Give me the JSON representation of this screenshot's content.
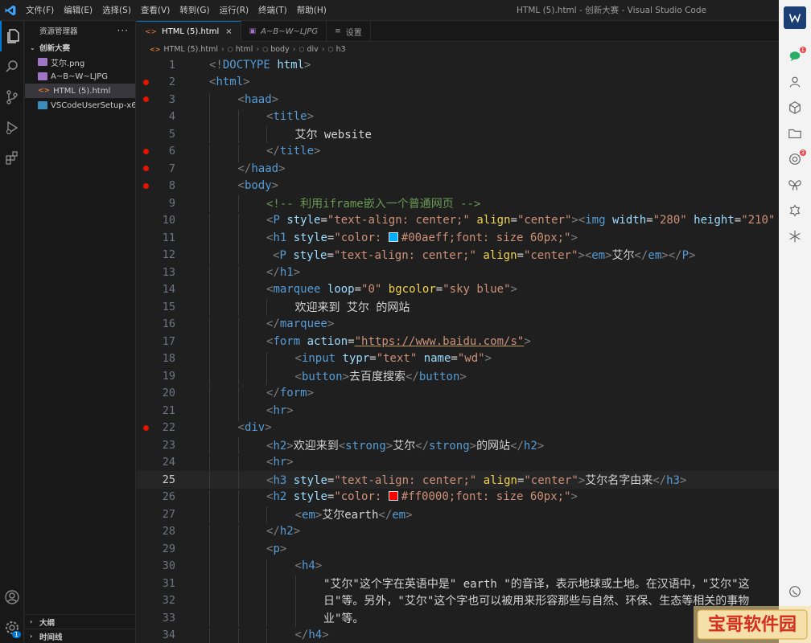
{
  "window": {
    "title": "HTML (5).html - 创新大赛 - Visual Studio Code",
    "menus": [
      "文件(F)",
      "编辑(E)",
      "选择(S)",
      "查看(V)",
      "转到(G)",
      "运行(R)",
      "终端(T)",
      "帮助(H)"
    ]
  },
  "sidebar": {
    "title": "资源管理器",
    "more": "···",
    "folder": "创新大赛",
    "files": [
      {
        "name": "艾尔.png",
        "kind": "image-file-icon"
      },
      {
        "name": "A~B~W~LJPG",
        "kind": "image-file-icon"
      },
      {
        "name": "HTML (5).html",
        "kind": "html-file-icon",
        "selected": true
      },
      {
        "name": "VSCodeUserSetup-x6...",
        "kind": "exe-file-icon"
      }
    ],
    "outline": "大纲",
    "timeline": "时间线"
  },
  "tabs": [
    {
      "label": "HTML (5).html",
      "icon": "<>",
      "active": true,
      "close": "×"
    },
    {
      "label": "A~B~W~LJPG",
      "icon": "▣",
      "italic": true
    },
    {
      "label": "设置",
      "icon": "≡"
    }
  ],
  "breadcrumb": [
    "HTML (5).html",
    "html",
    "body",
    "div",
    "h3"
  ],
  "editor": {
    "current_line": 25,
    "lines": [
      {
        "n": "1",
        "bp": false,
        "indent": 0,
        "toks": [
          [
            "p",
            "<!"
          ],
          [
            "t",
            "DOCTYPE"
          ],
          [
            "x",
            " "
          ],
          [
            "a",
            "html"
          ],
          [
            "p",
            ">"
          ]
        ]
      },
      {
        "n": "2",
        "bp": true,
        "indent": 0,
        "toks": [
          [
            "p",
            "<"
          ],
          [
            "t",
            "html"
          ],
          [
            "p",
            ">"
          ]
        ]
      },
      {
        "n": "3",
        "bp": true,
        "indent": 1,
        "toks": [
          [
            "p",
            "<"
          ],
          [
            "t",
            "haad"
          ],
          [
            "p",
            ">"
          ]
        ]
      },
      {
        "n": "4",
        "bp": false,
        "indent": 2,
        "toks": [
          [
            "p",
            "<"
          ],
          [
            "t",
            "title"
          ],
          [
            "p",
            ">"
          ]
        ]
      },
      {
        "n": "5",
        "bp": false,
        "indent": 3,
        "toks": [
          [
            "w",
            "艾尔 website"
          ]
        ]
      },
      {
        "n": "6",
        "bp": true,
        "indent": 2,
        "toks": [
          [
            "p",
            "</"
          ],
          [
            "t",
            "title"
          ],
          [
            "p",
            ">"
          ]
        ]
      },
      {
        "n": "7",
        "bp": true,
        "indent": 1,
        "toks": [
          [
            "p",
            "</"
          ],
          [
            "t",
            "haad"
          ],
          [
            "p",
            ">"
          ]
        ]
      },
      {
        "n": "8",
        "bp": true,
        "indent": 1,
        "toks": [
          [
            "p",
            "<"
          ],
          [
            "t",
            "body"
          ],
          [
            "p",
            ">"
          ]
        ]
      },
      {
        "n": "9",
        "bp": false,
        "indent": 2,
        "toks": [
          [
            "c",
            "<!-- 利用iframe嵌入一个普通网页 -->"
          ]
        ]
      },
      {
        "n": "10",
        "bp": false,
        "indent": 2,
        "toks": [
          [
            "p",
            "<"
          ],
          [
            "t",
            "P"
          ],
          [
            "x",
            " "
          ],
          [
            "a",
            "style"
          ],
          [
            "x",
            "="
          ],
          [
            "s",
            "\"text-align: center;\""
          ],
          [
            "x",
            " "
          ],
          [
            "e",
            "align"
          ],
          [
            "x",
            "="
          ],
          [
            "s",
            "\"center\""
          ],
          [
            "p",
            "><"
          ],
          [
            "t",
            "img"
          ],
          [
            "x",
            " "
          ],
          [
            "a",
            "width"
          ],
          [
            "x",
            "="
          ],
          [
            "s",
            "\"280\""
          ],
          [
            "x",
            " "
          ],
          [
            "a",
            "height"
          ],
          [
            "x",
            "="
          ],
          [
            "s",
            "\"210\""
          ]
        ]
      },
      {
        "n": "11",
        "bp": false,
        "indent": 2,
        "toks": [
          [
            "p",
            "<"
          ],
          [
            "t",
            "h1"
          ],
          [
            "x",
            " "
          ],
          [
            "a",
            "style"
          ],
          [
            "x",
            "="
          ],
          [
            "s",
            "\"color: "
          ],
          [
            "sw",
            "#00aeff"
          ],
          [
            "s",
            "#00aeff;font: size 60px;\""
          ],
          [
            "p",
            ">"
          ]
        ]
      },
      {
        "n": "12",
        "bp": false,
        "indent": 2,
        "pad": 1,
        "toks": [
          [
            "p",
            "<"
          ],
          [
            "t",
            "P"
          ],
          [
            "x",
            " "
          ],
          [
            "a",
            "style"
          ],
          [
            "x",
            "="
          ],
          [
            "s",
            "\"text-align: center;\""
          ],
          [
            "x",
            " "
          ],
          [
            "e",
            "align"
          ],
          [
            "x",
            "="
          ],
          [
            "s",
            "\"center\""
          ],
          [
            "p",
            "><"
          ],
          [
            "t",
            "em"
          ],
          [
            "p",
            ">"
          ],
          [
            "w",
            "艾尔"
          ],
          [
            "p",
            "</"
          ],
          [
            "t",
            "em"
          ],
          [
            "p",
            "></"
          ],
          [
            "t",
            "P"
          ],
          [
            "p",
            ">"
          ]
        ]
      },
      {
        "n": "13",
        "bp": false,
        "indent": 2,
        "toks": [
          [
            "p",
            "</"
          ],
          [
            "t",
            "h1"
          ],
          [
            "p",
            ">"
          ]
        ]
      },
      {
        "n": "14",
        "bp": false,
        "indent": 2,
        "toks": [
          [
            "p",
            "<"
          ],
          [
            "t",
            "marquee"
          ],
          [
            "x",
            " "
          ],
          [
            "a",
            "loop"
          ],
          [
            "x",
            "="
          ],
          [
            "s",
            "\"0\""
          ],
          [
            "x",
            " "
          ],
          [
            "e",
            "bgcolor"
          ],
          [
            "x",
            "="
          ],
          [
            "s",
            "\"sky blue\""
          ],
          [
            "p",
            ">"
          ]
        ]
      },
      {
        "n": "15",
        "bp": false,
        "indent": 3,
        "toks": [
          [
            "w",
            "欢迎来到 艾尔 的网站"
          ]
        ]
      },
      {
        "n": "16",
        "bp": false,
        "indent": 2,
        "toks": [
          [
            "p",
            "</"
          ],
          [
            "t",
            "marquee"
          ],
          [
            "p",
            ">"
          ]
        ]
      },
      {
        "n": "17",
        "bp": false,
        "indent": 2,
        "toks": [
          [
            "p",
            "<"
          ],
          [
            "t",
            "form"
          ],
          [
            "x",
            " "
          ],
          [
            "a",
            "action"
          ],
          [
            "x",
            "="
          ],
          [
            "su",
            "\"https://www.baidu.com/s\""
          ],
          [
            "p",
            ">"
          ]
        ]
      },
      {
        "n": "18",
        "bp": false,
        "indent": 3,
        "toks": [
          [
            "p",
            "<"
          ],
          [
            "t",
            "input"
          ],
          [
            "x",
            " "
          ],
          [
            "a",
            "typr"
          ],
          [
            "x",
            "="
          ],
          [
            "s",
            "\"text\""
          ],
          [
            "x",
            " "
          ],
          [
            "a",
            "name"
          ],
          [
            "x",
            "="
          ],
          [
            "s",
            "\"wd\""
          ],
          [
            "p",
            ">"
          ]
        ]
      },
      {
        "n": "19",
        "bp": false,
        "indent": 3,
        "toks": [
          [
            "p",
            "<"
          ],
          [
            "t",
            "button"
          ],
          [
            "p",
            ">"
          ],
          [
            "w",
            "去百度搜索"
          ],
          [
            "p",
            "</"
          ],
          [
            "t",
            "button"
          ],
          [
            "p",
            ">"
          ]
        ]
      },
      {
        "n": "20",
        "bp": false,
        "indent": 2,
        "toks": [
          [
            "p",
            "</"
          ],
          [
            "t",
            "form"
          ],
          [
            "p",
            ">"
          ]
        ]
      },
      {
        "n": "21",
        "bp": false,
        "indent": 2,
        "toks": [
          [
            "p",
            "<"
          ],
          [
            "t",
            "hr"
          ],
          [
            "p",
            ">"
          ]
        ]
      },
      {
        "n": "22",
        "bp": true,
        "indent": 1,
        "toks": [
          [
            "p",
            "<"
          ],
          [
            "t",
            "div"
          ],
          [
            "p",
            ">"
          ]
        ]
      },
      {
        "n": "23",
        "bp": false,
        "indent": 2,
        "toks": [
          [
            "p",
            "<"
          ],
          [
            "t",
            "h2"
          ],
          [
            "p",
            ">"
          ],
          [
            "w",
            "欢迎来到"
          ],
          [
            "p",
            "<"
          ],
          [
            "t",
            "strong"
          ],
          [
            "p",
            ">"
          ],
          [
            "w",
            "艾尔"
          ],
          [
            "p",
            "</"
          ],
          [
            "t",
            "strong"
          ],
          [
            "p",
            ">"
          ],
          [
            "w",
            "的网站"
          ],
          [
            "p",
            "</"
          ],
          [
            "t",
            "h2"
          ],
          [
            "p",
            ">"
          ]
        ]
      },
      {
        "n": "24",
        "bp": false,
        "indent": 2,
        "toks": [
          [
            "p",
            "<"
          ],
          [
            "t",
            "hr"
          ],
          [
            "p",
            ">"
          ]
        ]
      },
      {
        "n": "25",
        "bp": false,
        "indent": 2,
        "toks": [
          [
            "p",
            "<"
          ],
          [
            "t",
            "h3"
          ],
          [
            "x",
            " "
          ],
          [
            "a",
            "style"
          ],
          [
            "x",
            "="
          ],
          [
            "s",
            "\"text-align: center;\""
          ],
          [
            "x",
            " "
          ],
          [
            "e",
            "align"
          ],
          [
            "x",
            "="
          ],
          [
            "s",
            "\"center\""
          ],
          [
            "p",
            ">"
          ],
          [
            "w",
            "艾尔名字由来"
          ],
          [
            "p",
            "</"
          ],
          [
            "t",
            "h3"
          ],
          [
            "p",
            ">"
          ]
        ]
      },
      {
        "n": "26",
        "bp": false,
        "indent": 2,
        "toks": [
          [
            "p",
            "<"
          ],
          [
            "t",
            "h2"
          ],
          [
            "x",
            " "
          ],
          [
            "a",
            "style"
          ],
          [
            "x",
            "="
          ],
          [
            "s",
            "\"color: "
          ],
          [
            "sw",
            "#ff0000"
          ],
          [
            "s",
            "#ff0000;font: size 60px;\""
          ],
          [
            "p",
            ">"
          ]
        ]
      },
      {
        "n": "27",
        "bp": false,
        "indent": 3,
        "toks": [
          [
            "p",
            "<"
          ],
          [
            "t",
            "em"
          ],
          [
            "p",
            ">"
          ],
          [
            "w",
            "艾尔earth"
          ],
          [
            "p",
            "</"
          ],
          [
            "t",
            "em"
          ],
          [
            "p",
            ">"
          ]
        ]
      },
      {
        "n": "28",
        "bp": false,
        "indent": 2,
        "toks": [
          [
            "p",
            "</"
          ],
          [
            "t",
            "h2"
          ],
          [
            "p",
            ">"
          ]
        ]
      },
      {
        "n": "29",
        "bp": false,
        "indent": 2,
        "toks": [
          [
            "p",
            "<"
          ],
          [
            "t",
            "p"
          ],
          [
            "p",
            ">"
          ]
        ]
      },
      {
        "n": "30",
        "bp": false,
        "indent": 3,
        "toks": [
          [
            "p",
            "<"
          ],
          [
            "t",
            "h4"
          ],
          [
            "p",
            ">"
          ]
        ]
      },
      {
        "n": "31",
        "bp": false,
        "indent": 4,
        "toks": [
          [
            "w",
            "\"艾尔\"这个字在英语中是\" earth \"的音译，表示地球或土地。在汉语中，\"艾尔\"这"
          ]
        ]
      },
      {
        "n": "32",
        "bp": false,
        "indent": 4,
        "toks": [
          [
            "w",
            "日\"等。另外，\"艾尔\"这个字也可以被用来形容那些与自然、环保、生态等相关的事物"
          ]
        ]
      },
      {
        "n": "33",
        "bp": false,
        "indent": 4,
        "toks": [
          [
            "w",
            "业\"等。"
          ]
        ]
      },
      {
        "n": "34",
        "bp": false,
        "indent": 3,
        "toks": [
          [
            "p",
            "</"
          ],
          [
            "t",
            "h4"
          ],
          [
            "p",
            ">"
          ]
        ]
      }
    ]
  },
  "right_rail": {
    "badges": [
      "1",
      "3"
    ]
  },
  "accounts_badge": "1",
  "watermark": {
    "text": "宝哥软件园"
  }
}
